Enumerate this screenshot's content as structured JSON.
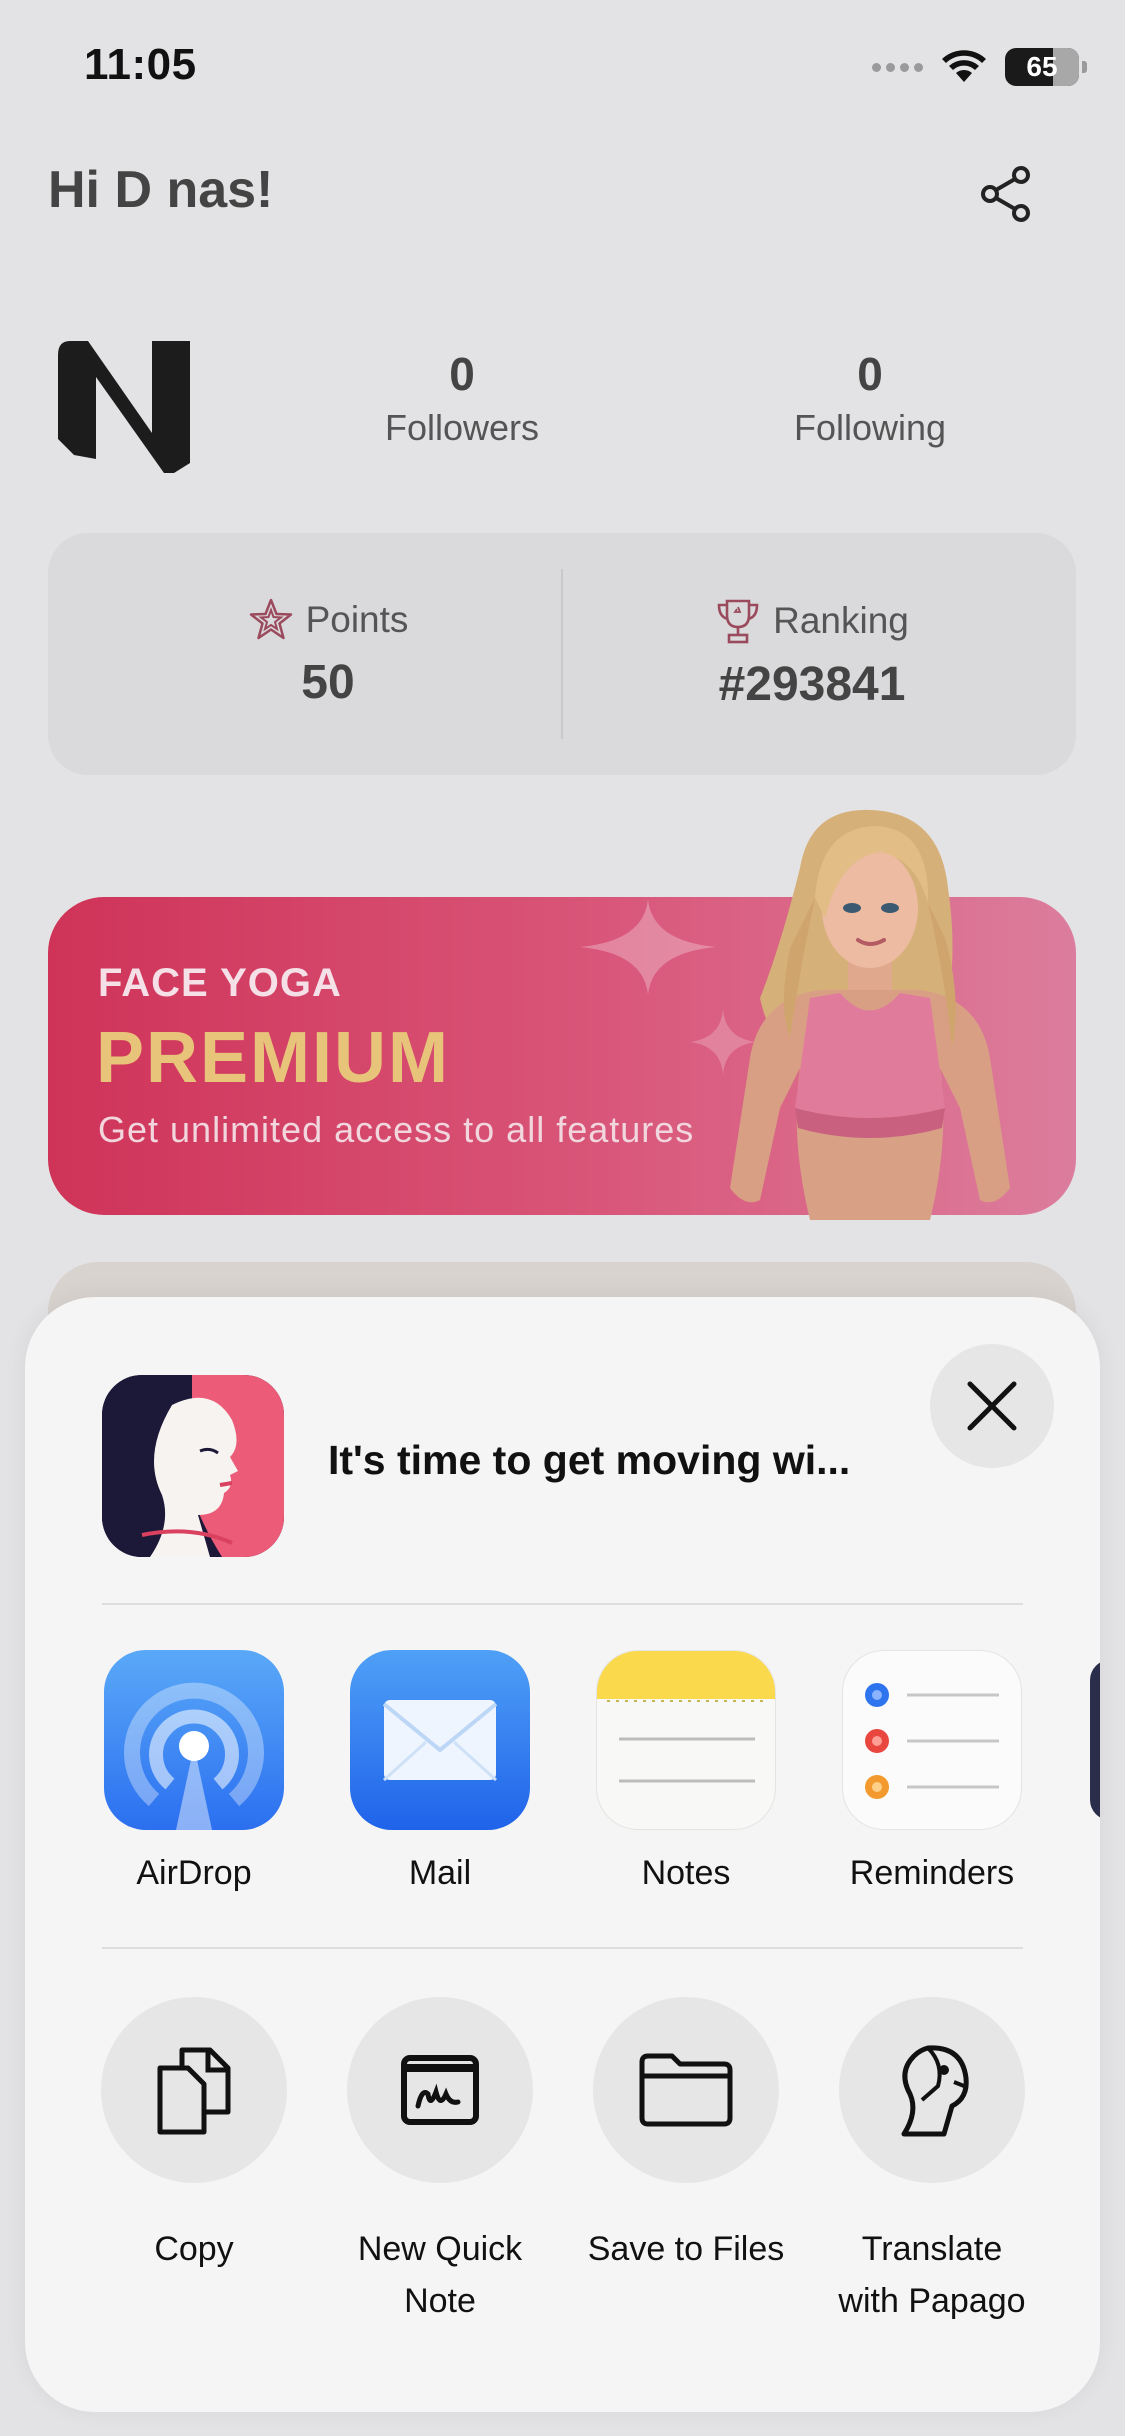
{
  "status_bar": {
    "time": "11:05",
    "battery": "65"
  },
  "header": {
    "greeting": "Hi D nas!",
    "share_icon": "share-icon"
  },
  "profile": {
    "logo_letter": "N",
    "followers": {
      "count": "0",
      "label": "Followers"
    },
    "following": {
      "count": "0",
      "label": "Following"
    }
  },
  "stats_card": {
    "points": {
      "label": "Points",
      "value": "50",
      "icon": "star-icon"
    },
    "ranking": {
      "label": "Ranking",
      "value": "#293841",
      "icon": "trophy-icon"
    }
  },
  "premium_banner": {
    "eyebrow": "FACE YOGA",
    "title": "PREMIUM",
    "subtitle": "Get unlimited access to all features",
    "colors": {
      "start": "#cf3358",
      "end": "#dc7d9d",
      "title": "#e8c37a"
    }
  },
  "share_sheet": {
    "title": "It's time to get moving wi...",
    "apps": [
      {
        "label": "AirDrop",
        "icon": "airdrop-icon"
      },
      {
        "label": "Mail",
        "icon": "mail-icon"
      },
      {
        "label": "Notes",
        "icon": "notes-icon"
      },
      {
        "label": "Reminders",
        "icon": "reminders-icon"
      }
    ],
    "actions": [
      {
        "label": "Copy",
        "icon": "copy-icon"
      },
      {
        "label": "New Quick\nNote",
        "icon": "quick-note-icon"
      },
      {
        "label": "Save to Files",
        "icon": "folder-icon"
      },
      {
        "label": "Translate\nwith Papago",
        "icon": "papago-icon"
      }
    ]
  }
}
